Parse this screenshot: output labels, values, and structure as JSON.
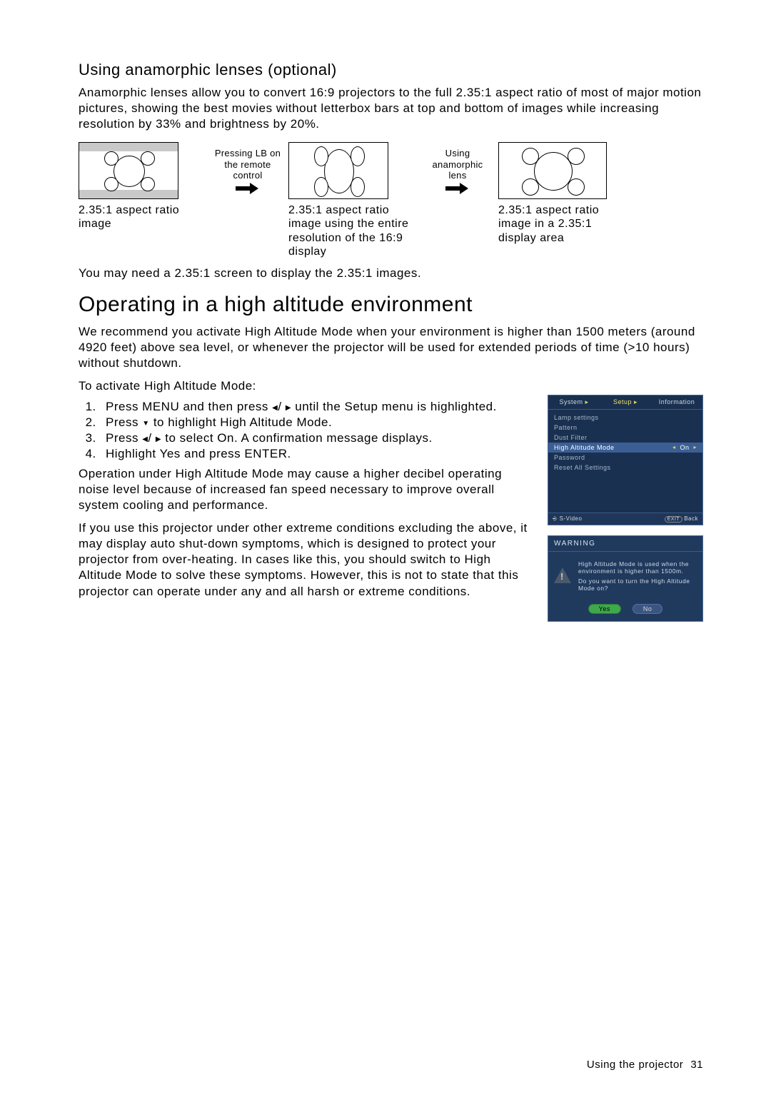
{
  "section1": {
    "heading": "Using anamorphic lenses (optional)",
    "para": "Anamorphic lenses allow you to convert 16:9 projectors to the full 2.35:1 aspect ratio of most of major motion pictures, showing the best movies without letterbox bars at top and bottom of images while increasing resolution by 33% and brightness by 20%."
  },
  "diagrams": {
    "cap1": "2.35:1 aspect ratio image",
    "trans1": "Pressing LB on the remote control",
    "cap2": "2.35:1 aspect ratio image using the entire resolution of the 16:9 display",
    "trans2": "Using anamorphic lens",
    "cap3": "2.35:1 aspect ratio image in a 2.35:1 display area",
    "note": "You may need a 2.35:1 screen to display the 2.35:1 images."
  },
  "section2": {
    "heading": "Operating in a high altitude environment",
    "para": "We recommend you activate High Altitude Mode when your environment is higher than 1500 meters (around 4920 feet) above sea level, or whenever the projector will be used for extended periods of time (>10 hours) without shutdown.",
    "intro": "To activate High Altitude Mode:",
    "steps_p1a": "Press MENU and then press ",
    "steps_p1b": " until the Setup menu is highlighted.",
    "steps_p2a": "Press ",
    "steps_p2b": " to highlight High Altitude Mode.",
    "steps_p3a": "Press ",
    "steps_p3b": " to select On. A confirmation message displays.",
    "steps_p4": "Highlight Yes and press ENTER.",
    "after1": "Operation under High Altitude Mode may cause a higher decibel operating noise level because of increased fan speed necessary to improve overall system cooling and performance.",
    "after2": "If you use this projector under other extreme conditions excluding the above, it may display auto shut-down symptoms, which is designed to protect your projector from over-heating. In cases like this, you should switch to High Altitude Mode to solve these symptoms. However, this is not to state that this projector can operate under any and all harsh or extreme conditions."
  },
  "osd": {
    "tab1": "System",
    "tab2": "Setup",
    "tab3": "Information",
    "rows": {
      "r1": "Lamp settings",
      "r2": "Pattern",
      "r3": "Dust Filter",
      "r4": "High Altitude Mode",
      "r4v": "On",
      "r5": "Password",
      "r6": "Reset All Settings"
    },
    "footer_src": "S-Video",
    "footer_exit": "EXIT",
    "footer_back": "Back"
  },
  "warning": {
    "title": "WARNING",
    "msg1": "High Altitude Mode is used when the environment is higher than 1500m.",
    "msg2": "Do you want to turn the High Altitude Mode on?",
    "yes": "Yes",
    "no": "No"
  },
  "footer": {
    "label": "Using the projector",
    "page": "31"
  }
}
